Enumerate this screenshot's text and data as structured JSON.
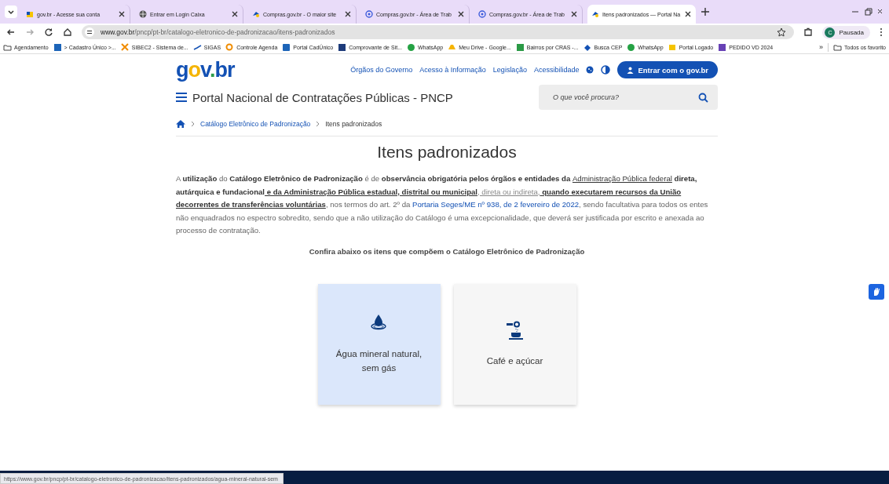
{
  "browser": {
    "tabs": [
      {
        "title": "gov.br - Acesse sua conta",
        "selected": false
      },
      {
        "title": "Entrar em Login Caixa",
        "selected": false
      },
      {
        "title": "Compras.gov.br - O maior site",
        "selected": false
      },
      {
        "title": "Compras.gov.br - Área de Trab",
        "selected": false
      },
      {
        "title": "Compras.gov.br - Área de Trab",
        "selected": false
      },
      {
        "title": "Itens padronizados — Portal Na",
        "selected": true
      }
    ],
    "address": {
      "host": "www.gov.br",
      "path": "/pncp/pt-br/catalogo-eletronico-de-padronizacao/itens-padronizados"
    },
    "profile": {
      "initial": "C",
      "label": "Pausada"
    },
    "bookmarks": [
      "Agendamento",
      "> Cadastro Único >...",
      "SIBEC2 - Sistema de...",
      "SIGAS",
      "Controle Agenda",
      "Portal CadÚnico",
      "Comprovante de Sit...",
      "WhatsApp",
      "Meu Drive - Google...",
      "Bairros por CRAS -...",
      "Busca CEP",
      "WhatsApp",
      "Portal Logado",
      "PEDIDO VD 2024"
    ],
    "more": "»",
    "all_bookmarks": "Todos os favorito"
  },
  "header": {
    "logo": "gov.br",
    "links": [
      "Órgãos do Governo",
      "Acesso à Informação",
      "Legislação",
      "Acessibilidade"
    ],
    "login": "Entrar com o gov.br",
    "site_title": "Portal Nacional de Contratações Públicas - PNCP",
    "search": {
      "placeholder": "O que você procura?"
    }
  },
  "breadcrumb": [
    "Catálogo Eletrônico de Padronização",
    "Itens padronizados"
  ],
  "heading": "Itens padronizados",
  "intro": [
    {
      "kind": "plain",
      "text": "A "
    },
    {
      "kind": "bold",
      "text": "utilização"
    },
    {
      "kind": "plain",
      "text": " do "
    },
    {
      "kind": "bold",
      "text": "Catálogo Eletrônico de Padronização"
    },
    {
      "kind": "plain",
      "text": " é de "
    },
    {
      "kind": "bold",
      "text": "observância obrigatória pelos órgãos e entidades da "
    },
    {
      "kind": "underline",
      "text": "Administração Pública federal"
    },
    {
      "kind": "bold",
      "text": " direta, autárquica e fundacional"
    },
    {
      "kind": "bold-underline",
      "text": " e da Administração Pública estadual, distrital ou municipal"
    },
    {
      "kind": "light-underline",
      "text": ", direta ou indireta,"
    },
    {
      "kind": "bold-underline",
      "text": " quando executarem recursos da União decorrentes de transferências voluntárias"
    },
    {
      "kind": "plain",
      "text": ", nos termos do art. 2º da "
    },
    {
      "kind": "link",
      "text": "Portaria Seges/ME nº 938, de 2 fevereiro de 2022"
    },
    {
      "kind": "plain",
      "text": ", sendo facultativa para todos os entes não enquadrados no espectro sobredito, sendo que a não utilização do Catálogo é uma excepcionalidade, que deverá ser justificada por escrito e anexada ao processo de contratação."
    }
  ],
  "subheading": "Confira abaixo os itens que compõem o Catálogo Eletrônico de Padronização",
  "cards": [
    {
      "kind": "water",
      "label": "Água mineral natural, sem gás",
      "selected": true
    },
    {
      "kind": "coffee",
      "label": "Café e açúcar",
      "selected": false
    }
  ],
  "status_url": "https://www.gov.br/pncp/pt-br/catalogo-eletronico-de-padronizacao/itens-padronizados/agua-mineral-natural-sem"
}
